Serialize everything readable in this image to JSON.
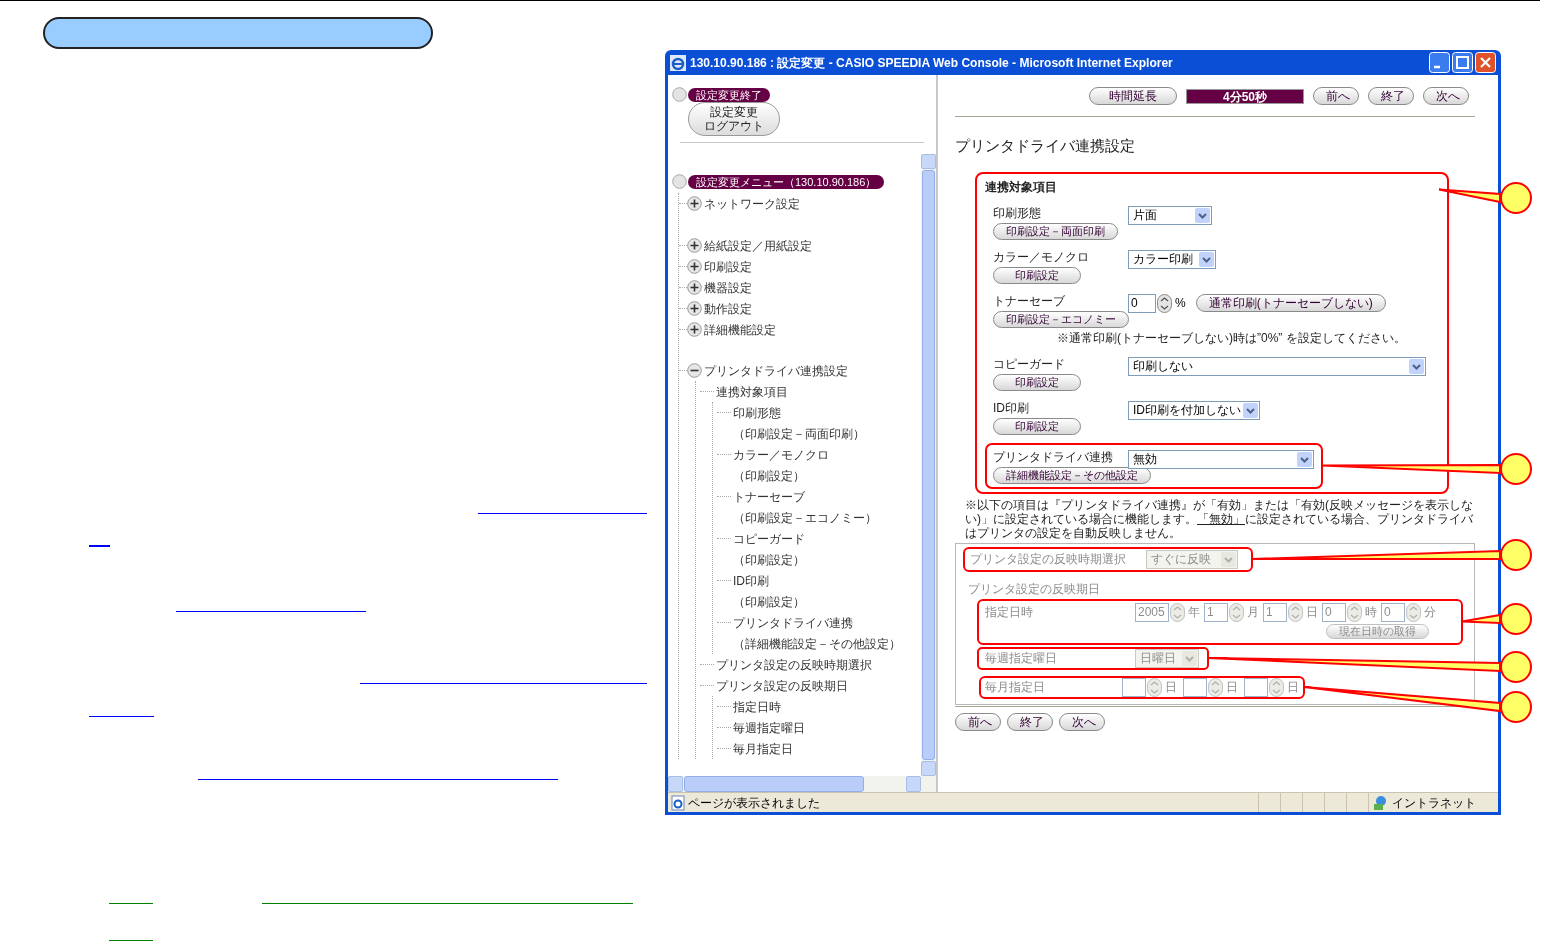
{
  "window": {
    "title": "130.10.90.186 : 設定変更 - CASIO SPEEDIA Web Console - Microsoft Internet Explorer"
  },
  "sidebar": {
    "logout_header": "設定変更終了",
    "logout_button": [
      "設定変更",
      "ログアウト"
    ],
    "menu_header": "設定変更メニュー（130.10.90.186）",
    "tree": [
      {
        "label": "ネットワーク設定",
        "expanded": false
      },
      {
        "label": "給紙設定／用紙設定",
        "expanded": false
      },
      {
        "label": "印刷設定",
        "expanded": false
      },
      {
        "label": "機器設定",
        "expanded": false
      },
      {
        "label": "動作設定",
        "expanded": false
      },
      {
        "label": "詳細機能設定",
        "expanded": false
      },
      {
        "label": "プリンタドライバ連携設定",
        "expanded": true,
        "children": [
          {
            "label": "連携対象項目",
            "children": [
              {
                "label": "印刷形態",
                "note": "（印刷設定－両面印刷）"
              },
              {
                "label": "カラー／モノクロ",
                "note": "（印刷設定）"
              },
              {
                "label": "トナーセーブ",
                "note": "（印刷設定－エコノミー）"
              },
              {
                "label": "コピーガード",
                "note": "（印刷設定）"
              },
              {
                "label": "ID印刷",
                "note": "（印刷設定）"
              },
              {
                "label": "プリンタドライバ連携",
                "note": "（詳細機能設定－その他設定）"
              }
            ]
          },
          {
            "label": "プリンタ設定の反映時期選択"
          },
          {
            "label": "プリンタ設定の反映期日",
            "children": [
              {
                "label": "指定日時"
              },
              {
                "label": "毎週指定曜日"
              },
              {
                "label": "毎月指定日"
              }
            ]
          }
        ]
      }
    ]
  },
  "toolbar": {
    "extend_button": "時間延長",
    "timer": "4分50秒",
    "nav": [
      "前へ",
      "終了",
      "次へ"
    ]
  },
  "heading": "プリンタドライバ連携設定",
  "section": {
    "title": "連携対象項目",
    "rows": [
      {
        "kind": "select",
        "label": "印刷形態",
        "button": "印刷設定－両面印刷",
        "value": "片面"
      },
      {
        "kind": "select",
        "label": "カラー／モノクロ",
        "button": "印刷設定",
        "value": "カラー印刷"
      },
      {
        "kind": "spinner",
        "label": "トナーセーブ",
        "button": "印刷設定－エコノミー",
        "value": "0",
        "unit": "%",
        "action": "通常印刷(トナーセーブしない)",
        "note": "※通常印刷(トナーセーブしない)時は”0%” を設定してください。"
      },
      {
        "kind": "select",
        "label": "コピーガード",
        "button": "印刷設定",
        "value": "印刷しない"
      },
      {
        "kind": "select",
        "label": "ID印刷",
        "button": "印刷設定",
        "value": "ID印刷を付加しない"
      },
      {
        "kind": "select",
        "label": "プリンタドライバ連携",
        "button": "詳細機能設定－その他設定",
        "value": "無効"
      }
    ]
  },
  "note": {
    "before": "※以下の項目は『プリンタドライバ連携』が「有効」または「有効(反映メッセージを表示しない)」に設定されている場合に機能します。",
    "link": "「無効」",
    "after": "に設定されている場合、プリンタドライバはプリンタの設定を自動反映しません。"
  },
  "schedule": {
    "disabled": true,
    "timing_label": "プリンタ設定の反映時期選択",
    "timing_value": "すぐに反映",
    "date_group": "プリンタ設定の反映期日",
    "datetime": {
      "label": "指定日時",
      "fields": [
        {
          "value": "2005",
          "unit": "年"
        },
        {
          "value": "1",
          "unit": "月"
        },
        {
          "value": "1",
          "unit": "日"
        },
        {
          "value": "0",
          "unit": "時"
        },
        {
          "value": "0",
          "unit": "分"
        }
      ],
      "button": "現在日時の取得"
    },
    "weekly": {
      "label": "毎週指定曜日",
      "value": "日曜日"
    },
    "monthly": {
      "label": "毎月指定日",
      "fields": [
        {
          "unit": "日"
        },
        {
          "unit": "日"
        },
        {
          "unit": "日"
        }
      ]
    }
  },
  "bottom_nav": [
    "前へ",
    "終了",
    "次へ"
  ],
  "status_bar": {
    "text": "ページが表示されました",
    "zone": "イントラネット"
  }
}
